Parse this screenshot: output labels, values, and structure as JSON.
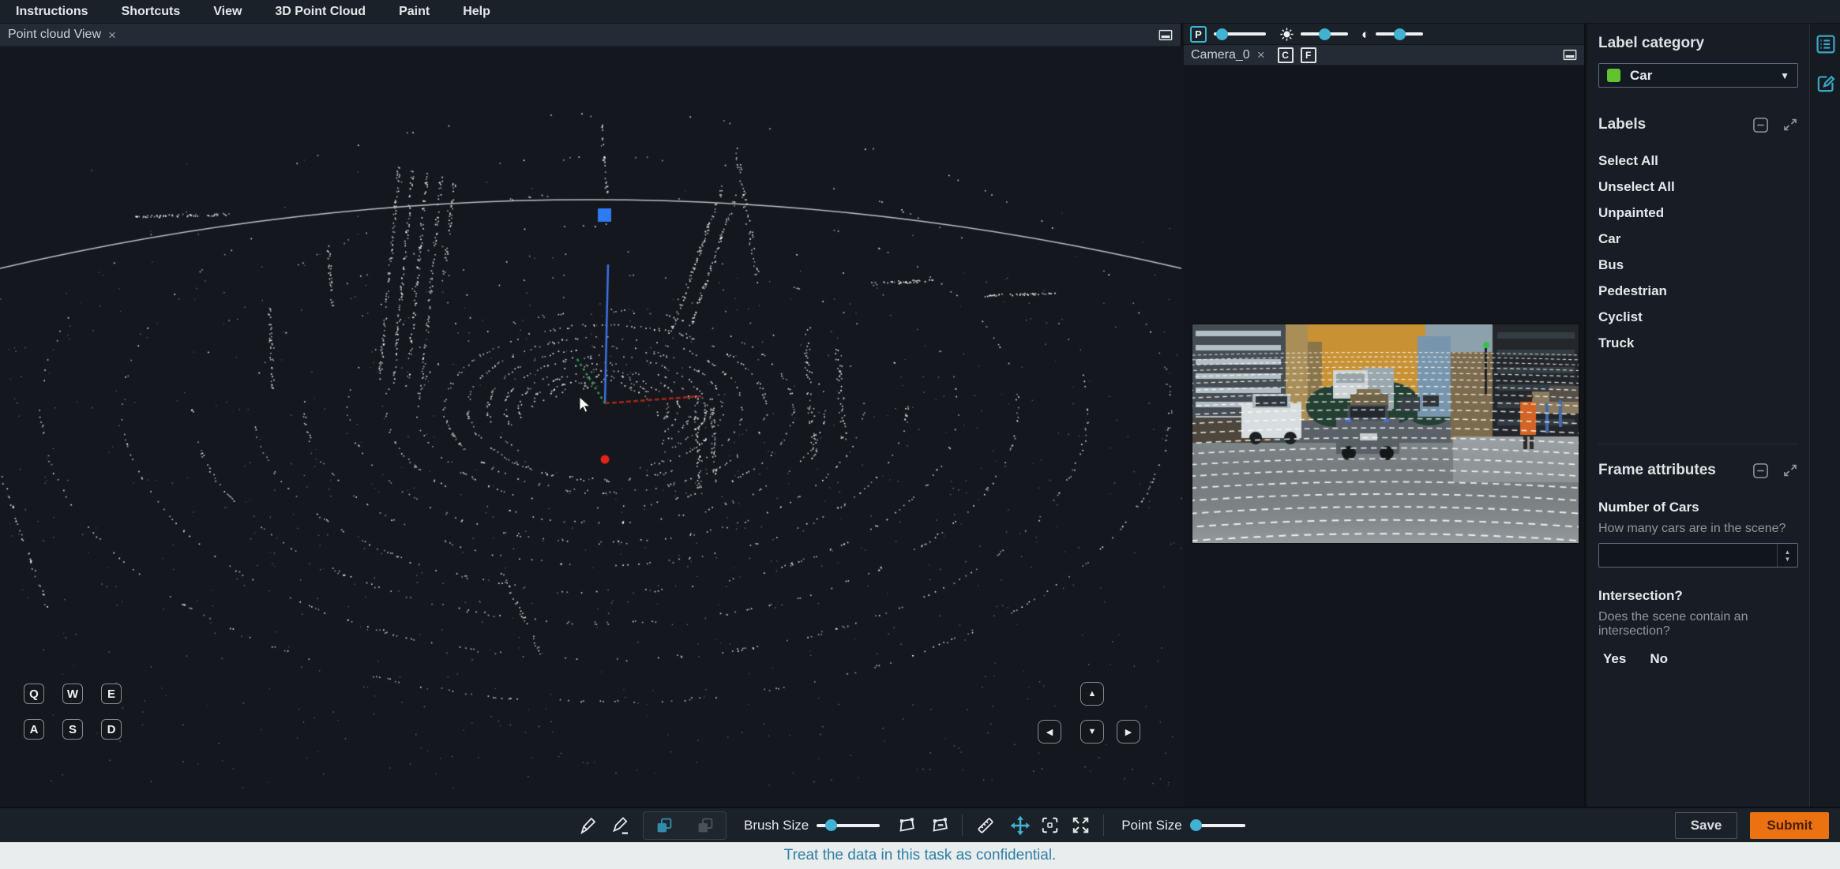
{
  "menu": {
    "items": [
      "Instructions",
      "Shortcuts",
      "View",
      "3D Point Cloud",
      "Paint",
      "Help"
    ]
  },
  "icons": {
    "close": "×",
    "chevron_down": "▼",
    "up": "▲",
    "down": "▼",
    "left": "◀",
    "right": "▶",
    "contrast": "◐",
    "stepper_up": "▲",
    "stepper_down": "▼"
  },
  "point_cloud_view": {
    "tab": "Point cloud View",
    "keys": [
      "Q",
      "W",
      "E",
      "A",
      "S",
      "D"
    ],
    "point_color": "#ffffff",
    "axes_colors": {
      "x_red": "#a8281a",
      "y_green": "#2da044",
      "z_blue": "#3b72e8"
    },
    "markers": {
      "selection_dot": "#e22418",
      "waypoint_square": "#2e7bf2"
    }
  },
  "camera_view": {
    "tab": "Camera_0",
    "projection_button": "P",
    "toggle_buttons": [
      "C",
      "F"
    ]
  },
  "display_sliders": {
    "p_intensity": 15,
    "brightness": 50,
    "contrast": 50
  },
  "sidebar": {
    "label_category": {
      "title": "Label category",
      "selected": "Car",
      "swatch_color": "#62c32f"
    },
    "labels": {
      "title": "Labels",
      "items": [
        "Select All",
        "Unselect All",
        "Unpainted",
        "Car",
        "Bus",
        "Pedestrian",
        "Cyclist",
        "Truck"
      ]
    },
    "frame_attributes": {
      "title": "Frame attributes",
      "fields": [
        {
          "label": "Number of Cars",
          "question": "How many cars are in the scene?",
          "value": ""
        },
        {
          "label": "Intersection?",
          "question": "Does the scene contain an intersection?",
          "options": [
            "Yes",
            "No"
          ]
        }
      ]
    }
  },
  "toolbar": {
    "brush_size_label": "Brush Size",
    "brush_size": 22,
    "point_size_label": "Point Size",
    "point_size": 10,
    "save_label": "Save",
    "submit_label": "Submit"
  },
  "footer": {
    "notice": "Treat the data in this task as confidential."
  },
  "colors": {
    "accent_cyan": "#41b2d1",
    "submit_orange": "#ec7211",
    "footer_text": "#2e7fa6"
  }
}
